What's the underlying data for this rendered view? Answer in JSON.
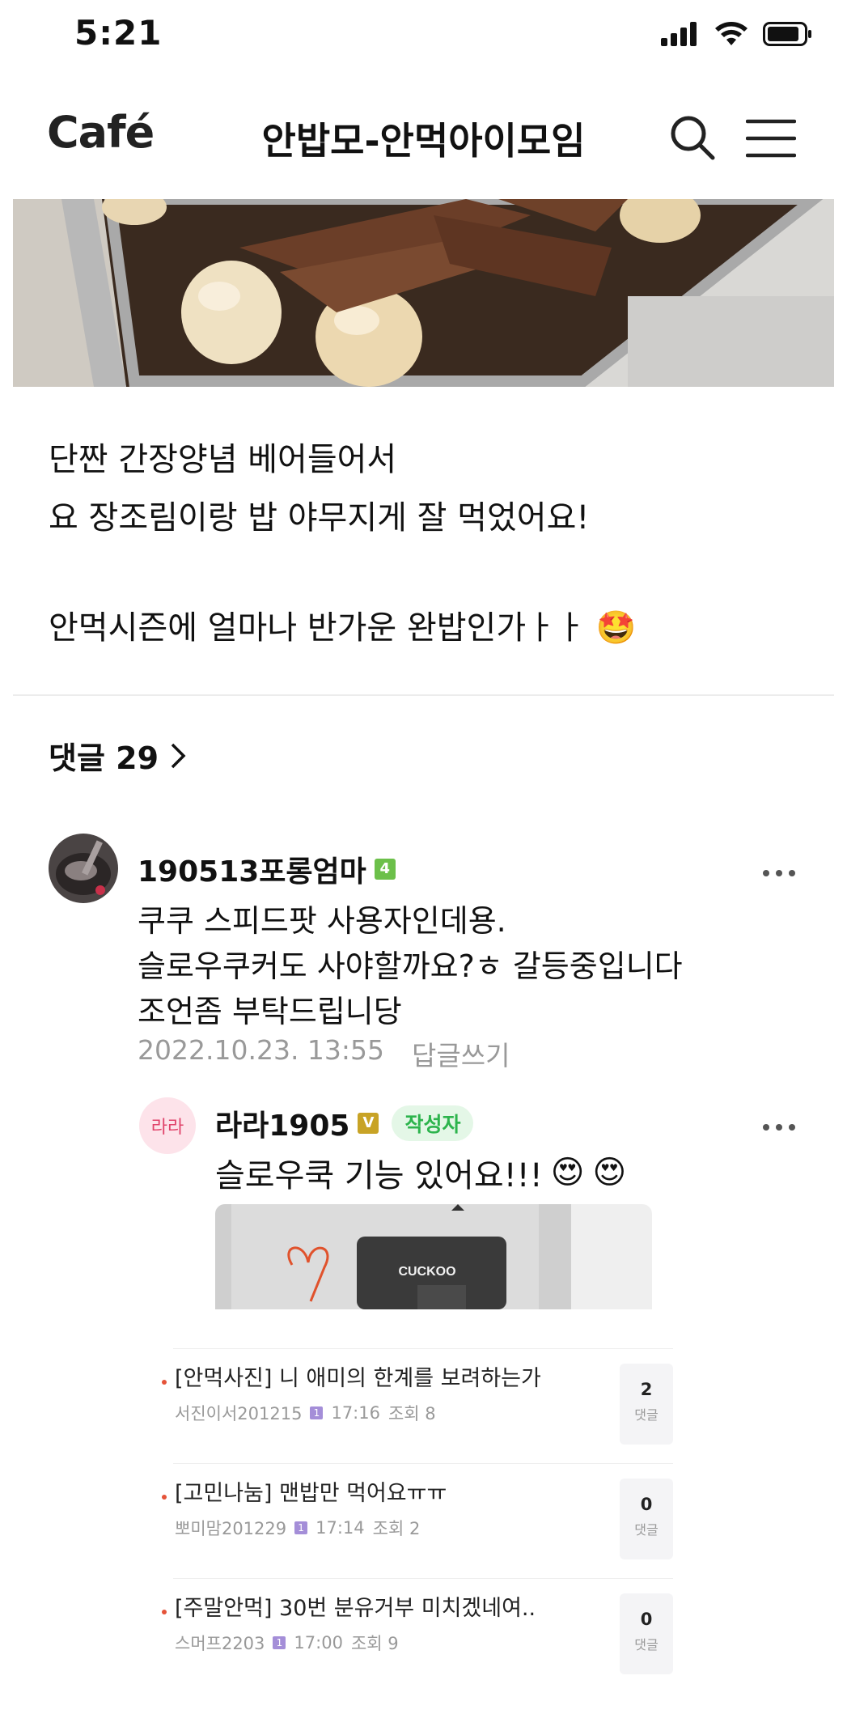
{
  "status_bar": {
    "time": "5:21"
  },
  "nav": {
    "logo": "Café",
    "title": "안밥모-안먹아이모임"
  },
  "post": {
    "lines": [
      "단짠 간장양념 베어들어서",
      "요 장조림이랑 밥 야무지게 잘 먹었어요!",
      "안먹시즌에 얼마나 반가운 완밥인가ㅏㅏ"
    ],
    "emoji": "🤩"
  },
  "comments": {
    "header": "댓글 29",
    "items": [
      {
        "author": "190513포롱엄마",
        "level_badge": "4",
        "lines": [
          "쿠쿠 스피드팟 사용자인데용.",
          "슬로우쿠커도 사야할까요?ㅎ 갈등중입니다",
          "조언좀 부탁드립니당"
        ],
        "date": "2022.10.23. 13:55",
        "reply_label": "답글쓰기"
      },
      {
        "author": "라라1905",
        "avatar_text": "라라",
        "level_badge": "V",
        "author_tag": "작성자",
        "text": "슬로우쿡 기능 있어요!!!",
        "emoji": "😍",
        "photo_brand": "CUCKOO"
      }
    ]
  },
  "related_posts": [
    {
      "title": "[안먹사진] 니 애미의 한계를 보려하는가",
      "author": "서진이서201215",
      "badge": "1",
      "time": "17:16",
      "views": "조회 8",
      "count": "2",
      "count_label": "댓글"
    },
    {
      "title": "[고민나눔] 맨밥만 먹어요ㅠㅠ",
      "author": "뽀미맘201229",
      "badge": "1",
      "time": "17:14",
      "views": "조회 2",
      "count": "0",
      "count_label": "댓글"
    },
    {
      "title": "[주말안먹] 30번 분유거부 미치겠네여..",
      "author": "스머프2203",
      "badge": "1",
      "time": "17:00",
      "views": "조회 9",
      "count": "0",
      "count_label": "댓글"
    }
  ],
  "icons": {
    "signal": "cellular-signal-icon",
    "wifi": "wifi-icon",
    "battery": "battery-icon",
    "search": "search-icon",
    "menu": "hamburger-menu-icon",
    "chevron": "chevron-right-icon",
    "more": "more-dots-icon"
  }
}
